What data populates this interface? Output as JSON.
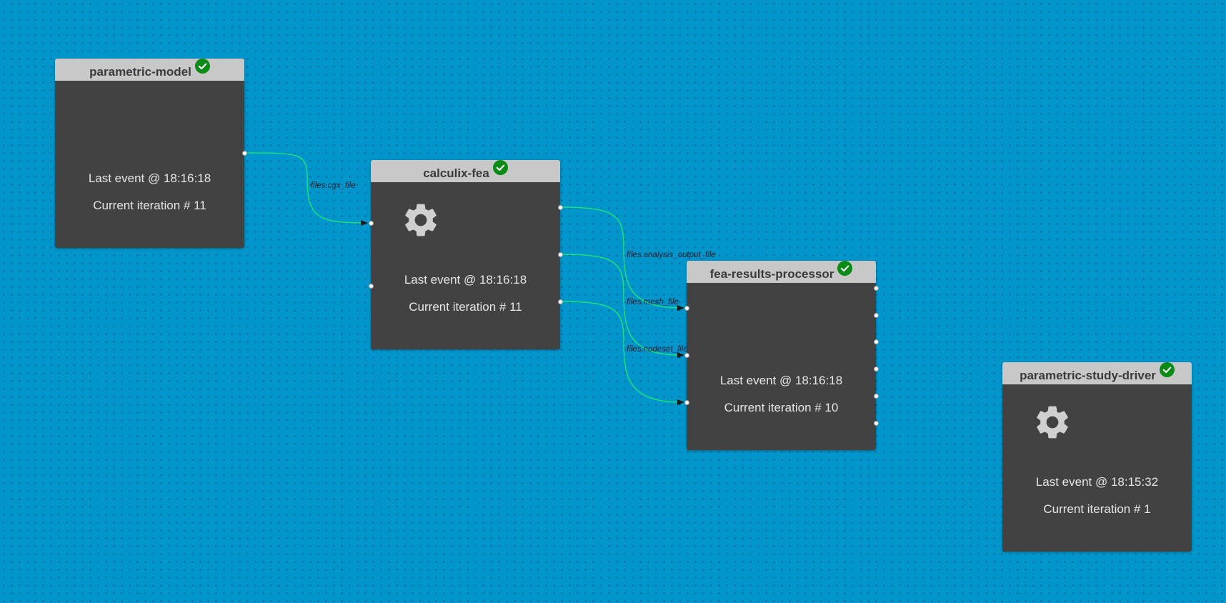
{
  "nodes": [
    {
      "id": "parametric-model",
      "title": "parametric-model",
      "status": "success",
      "icon": null,
      "last_event": "Last event @ 18:16:18",
      "iteration": "Current iteration # 11"
    },
    {
      "id": "calculix-fea",
      "title": "calculix-fea",
      "status": "success",
      "icon": "gear-icon",
      "last_event": "Last event @ 18:16:18",
      "iteration": "Current iteration # 11"
    },
    {
      "id": "fea-results-processor",
      "title": "fea-results-processor",
      "status": "success",
      "icon": null,
      "last_event": "Last event @ 18:16:18",
      "iteration": "Current iteration # 10"
    },
    {
      "id": "parametric-study-driver",
      "title": "parametric-study-driver",
      "status": "success",
      "icon": "gear-icon",
      "last_event": "Last event @ 18:15:32",
      "iteration": "Current iteration # 1"
    }
  ],
  "links": [
    {
      "from": "parametric-model",
      "to": "calculix-fea",
      "label": "files.cgx_file"
    },
    {
      "from": "calculix-fea",
      "to": "fea-results-processor",
      "label": "files.analysis_output_file"
    },
    {
      "from": "calculix-fea",
      "to": "fea-results-processor",
      "label": "files.mesh_file"
    },
    {
      "from": "calculix-fea",
      "to": "fea-results-processor",
      "label": "files.nodeset_file"
    }
  ],
  "colors": {
    "canvas_background": "#0095cb",
    "node_body": "#424242",
    "node_header": "#c8c8c8",
    "link_stroke": "#19e27a",
    "status_success": "#0b8a17"
  }
}
